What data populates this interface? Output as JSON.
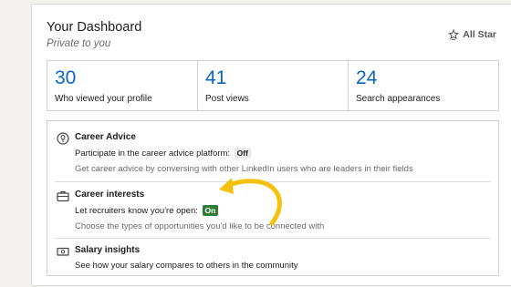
{
  "dashboard": {
    "title": "Your Dashboard",
    "subtitle": "Private to you",
    "all_star_label": "All Star"
  },
  "stats": [
    {
      "value": "30",
      "label": "Who viewed your profile"
    },
    {
      "value": "41",
      "label": "Post views"
    },
    {
      "value": "24",
      "label": "Search appearances"
    }
  ],
  "sections": {
    "career_advice": {
      "title": "Career Advice",
      "line1": "Participate in the career advice platform:",
      "badge": "Off",
      "line2": "Get career advice by conversing with other LinkedIn users who are leaders in their fields",
      "icon": "lightbulb-icon"
    },
    "career_interests": {
      "title": "Career interests",
      "line1": "Let recruiters know you're open:",
      "badge": "On",
      "line2": "Choose the types of opportunities you'd like to be connected with",
      "icon": "briefcase-icon"
    },
    "salary_insights": {
      "title": "Salary insights",
      "line1": "See how your salary compares to others in the community",
      "icon": "money-icon"
    }
  },
  "colors": {
    "accent": "#0a66c2",
    "on_badge": "#2e7d32",
    "annotation_arrow": "#f4c20d"
  }
}
